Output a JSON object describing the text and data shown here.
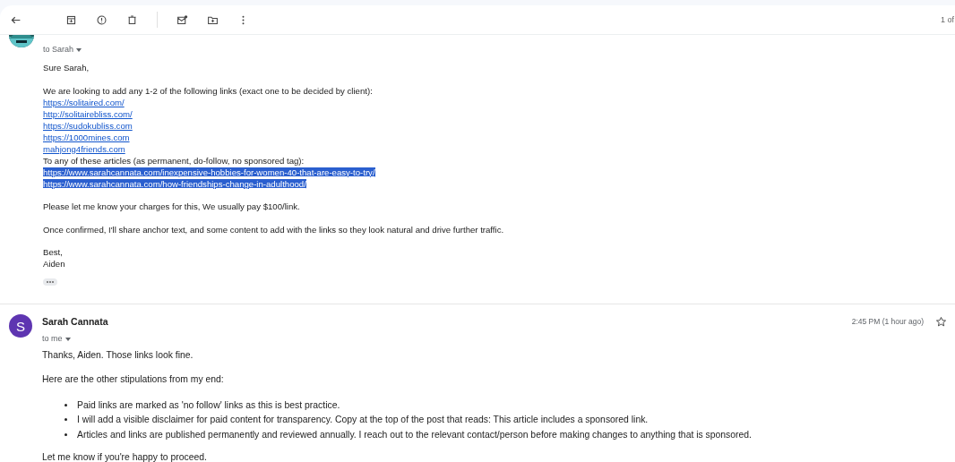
{
  "toolbar": {
    "page_count": "1 of"
  },
  "first_message": {
    "recipient": "to Sarah",
    "body": [
      {
        "kind": "text",
        "text": "Sure Sarah,"
      },
      {
        "kind": "gap"
      },
      {
        "kind": "text",
        "text": "We are looking to add any 1-2 of the following links (exact one to be decided by client):"
      },
      {
        "kind": "link",
        "text": "https://solitaired.com/",
        "highlighted": false
      },
      {
        "kind": "link",
        "text": "http://solitairebliss.com/",
        "highlighted": false
      },
      {
        "kind": "link",
        "text": "https://sudokubliss.com",
        "highlighted": false
      },
      {
        "kind": "link",
        "text": "https://1000mines.com",
        "highlighted": false
      },
      {
        "kind": "link",
        "text": "mahjong4friends.com",
        "highlighted": false
      },
      {
        "kind": "text",
        "text": "To any of these articles (as permanent, do-follow, no sponsored tag):"
      },
      {
        "kind": "link",
        "text": "https://www.sarahcannata.com/inexpensive-hobbies-for-women-40-that-are-easy-to-try/",
        "highlighted": true
      },
      {
        "kind": "link",
        "text": "https://www.sarahcannata.com/how-friendships-change-in-adulthood/",
        "highlighted": true
      },
      {
        "kind": "gap"
      },
      {
        "kind": "text",
        "text": "Please let me know your charges for this, We usually pay $100/link."
      },
      {
        "kind": "gap"
      },
      {
        "kind": "text",
        "text": "Once confirmed, I'll share anchor text, and some content to add with the links so they look natural and drive further traffic."
      },
      {
        "kind": "gap"
      },
      {
        "kind": "text",
        "text": "Best,"
      },
      {
        "kind": "text",
        "text": "Aiden"
      }
    ]
  },
  "second_message": {
    "avatar_letter": "S",
    "sender": "Sarah Cannata",
    "recipient": "to me",
    "time": "2:45 PM (1 hour ago)",
    "starred": false,
    "intro": [
      "Thanks, Aiden. Those links look fine.",
      "Here are the other stipulations from my end:"
    ],
    "bullets": [
      "Paid links are marked as 'no follow' links as this is best practice.",
      "I will add a visible disclaimer for paid content for transparency. Copy at the top of the post that reads: This article includes a sponsored link.",
      "Articles and links are published permanently and reviewed annually. I reach out to the relevant contact/person before making changes to anything that is sponsored."
    ],
    "closing": "Let me know if you're happy to proceed."
  }
}
